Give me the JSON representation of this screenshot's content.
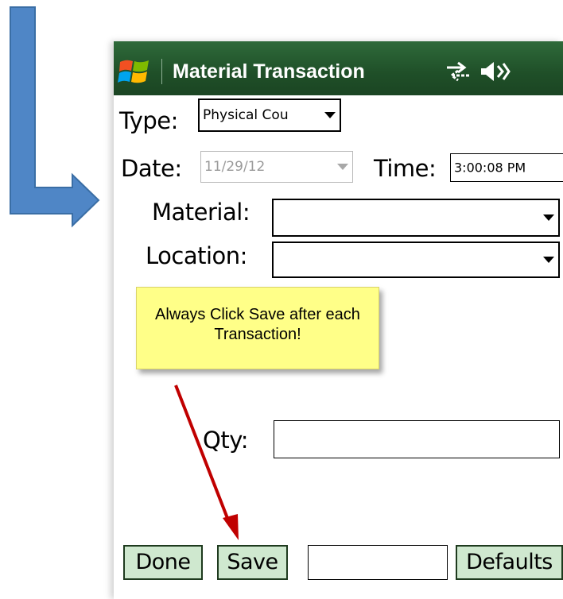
{
  "window": {
    "title": "Material Transaction"
  },
  "status_icons": [
    "windows-start-icon",
    "sync-icon",
    "volume-icon"
  ],
  "form": {
    "type": {
      "label": "Type:",
      "value": "Physical Cou"
    },
    "date": {
      "label": "Date:",
      "value": "11/29/12"
    },
    "time": {
      "label": "Time:",
      "value": "3:00:08 PM"
    },
    "material": {
      "label": "Material:",
      "value": ""
    },
    "location": {
      "label": "Location:",
      "value": ""
    },
    "qty": {
      "label": "Qty:",
      "value": ""
    }
  },
  "callout": {
    "text": "Always Click Save after each Transaction!"
  },
  "buttons": {
    "done": "Done",
    "save": "Save",
    "blank": "",
    "defaults": "Defaults"
  },
  "colors": {
    "titlebar": "#1f4f28",
    "button_fill": "#cfe8cf",
    "callout_fill": "#ffff88",
    "pointer_arrow": "#c00000",
    "annotation_arrow": "#4f86c6"
  }
}
